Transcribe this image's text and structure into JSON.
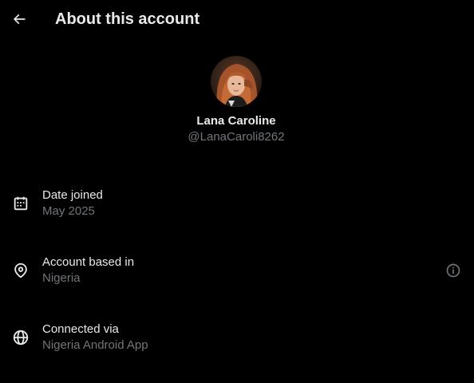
{
  "header": {
    "title": "About this account",
    "back_icon": "arrow-left-icon"
  },
  "profile": {
    "display_name": "Lana Caroline",
    "handle": "@LanaCaroli8262",
    "avatar_icon": "profile-photo"
  },
  "rows": [
    {
      "label": "Date joined",
      "value": "May 2025",
      "icon": "calendar-icon"
    },
    {
      "label": "Account based in",
      "value": "Nigeria",
      "icon": "location-pin-icon",
      "trailing_icon": "info-icon"
    },
    {
      "label": "Connected via",
      "value": "Nigeria Android App",
      "icon": "globe-icon"
    }
  ],
  "colors": {
    "background": "#000000",
    "primary_text": "#e7e9ea",
    "secondary_text": "#71767b"
  }
}
